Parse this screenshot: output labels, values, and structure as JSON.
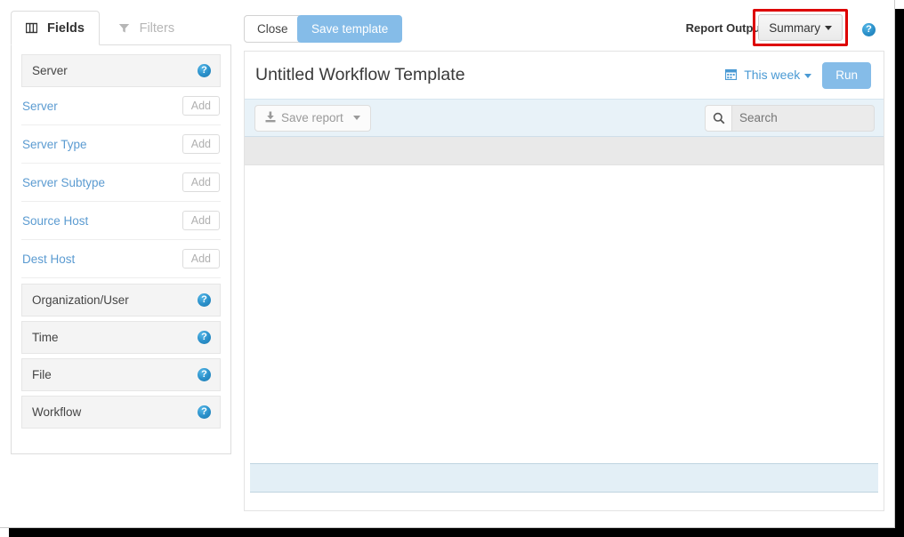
{
  "sidebar": {
    "tabs": [
      {
        "label": "Fields",
        "icon": "columns-icon",
        "active": true
      },
      {
        "label": "Filters",
        "icon": "funnel-icon",
        "active": false
      }
    ],
    "open_group": {
      "label": "Server",
      "help": "?"
    },
    "fields": [
      {
        "label": "Server",
        "add_label": "Add"
      },
      {
        "label": "Server Type",
        "add_label": "Add"
      },
      {
        "label": "Server Subtype",
        "add_label": "Add"
      },
      {
        "label": "Source Host",
        "add_label": "Add"
      },
      {
        "label": "Dest Host",
        "add_label": "Add"
      }
    ],
    "groups": [
      {
        "label": "Organization/User",
        "help": "?"
      },
      {
        "label": "Time",
        "help": "?"
      },
      {
        "label": "File",
        "help": "?"
      },
      {
        "label": "Workflow",
        "help": "?"
      }
    ]
  },
  "toolbar": {
    "close_label": "Close",
    "save_template_label": "Save template",
    "report_output_label": "Report Output:",
    "report_output_value": "Summary",
    "help": "?",
    "highlight_color": "#dd0000",
    "primary_color": "#85bce8"
  },
  "report": {
    "title": "Untitled Workflow Template",
    "date_range": "This week",
    "run_label": "Run",
    "save_report_label": "Save report",
    "search_placeholder": "Search",
    "search_value": "",
    "columns": [],
    "rows": [],
    "footer_text": ""
  }
}
